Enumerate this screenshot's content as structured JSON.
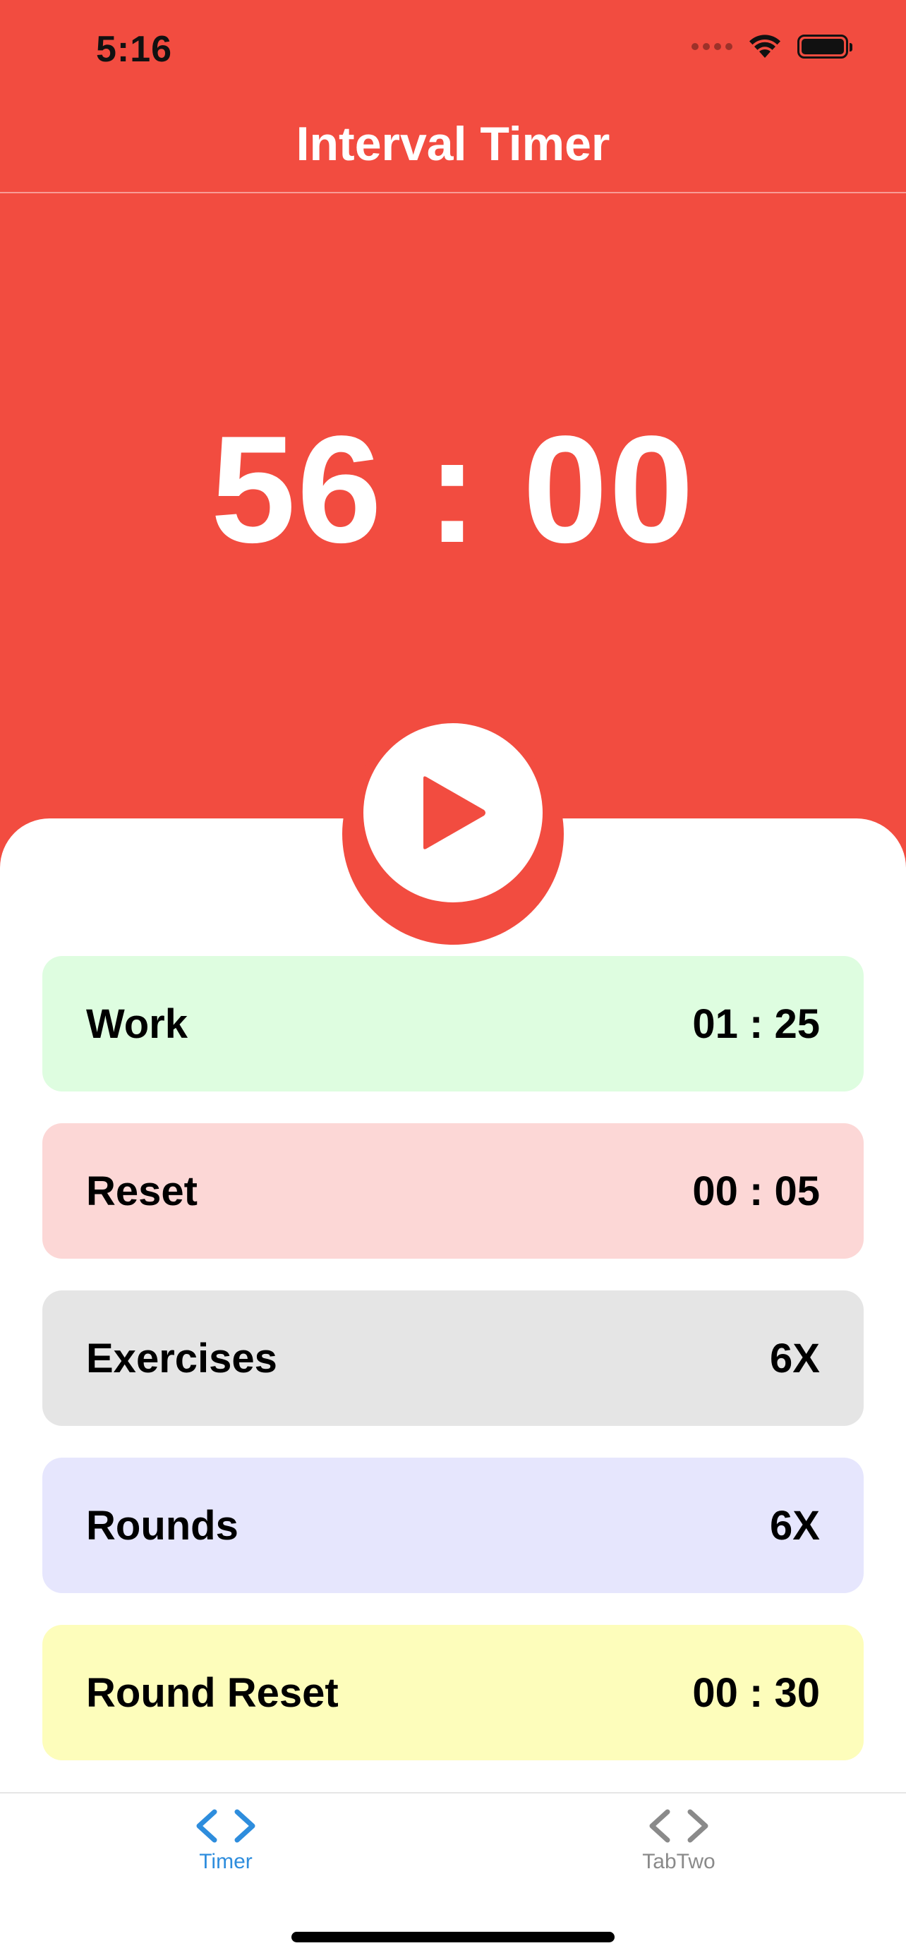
{
  "status_bar": {
    "time": "5:16"
  },
  "nav": {
    "title": "Interval Timer"
  },
  "timer": {
    "display": "56 : 00"
  },
  "play_button": {
    "icon": "play-icon"
  },
  "settings": [
    {
      "label": "Work",
      "value": "01 : 25",
      "color": "#defde0"
    },
    {
      "label": "Reset",
      "value": "00 : 05",
      "color": "#fcd7d6"
    },
    {
      "label": "Exercises",
      "value": "6X",
      "color": "#e5e5e5"
    },
    {
      "label": "Rounds",
      "value": "6X",
      "color": "#e6e6fd"
    },
    {
      "label": "Round Reset",
      "value": "00 : 30",
      "color": "#fdfdbb"
    }
  ],
  "tab_bar": {
    "tabs": [
      {
        "label": "Timer",
        "icon": "code-chevrons-icon",
        "active": true,
        "color": "#2e8ddd"
      },
      {
        "label": "TabTwo",
        "icon": "code-chevrons-icon",
        "active": false,
        "color": "#8a8a8a"
      }
    ]
  },
  "colors": {
    "accent": "#f24c40",
    "background_panel": "#ffffff",
    "text": "#000000"
  }
}
